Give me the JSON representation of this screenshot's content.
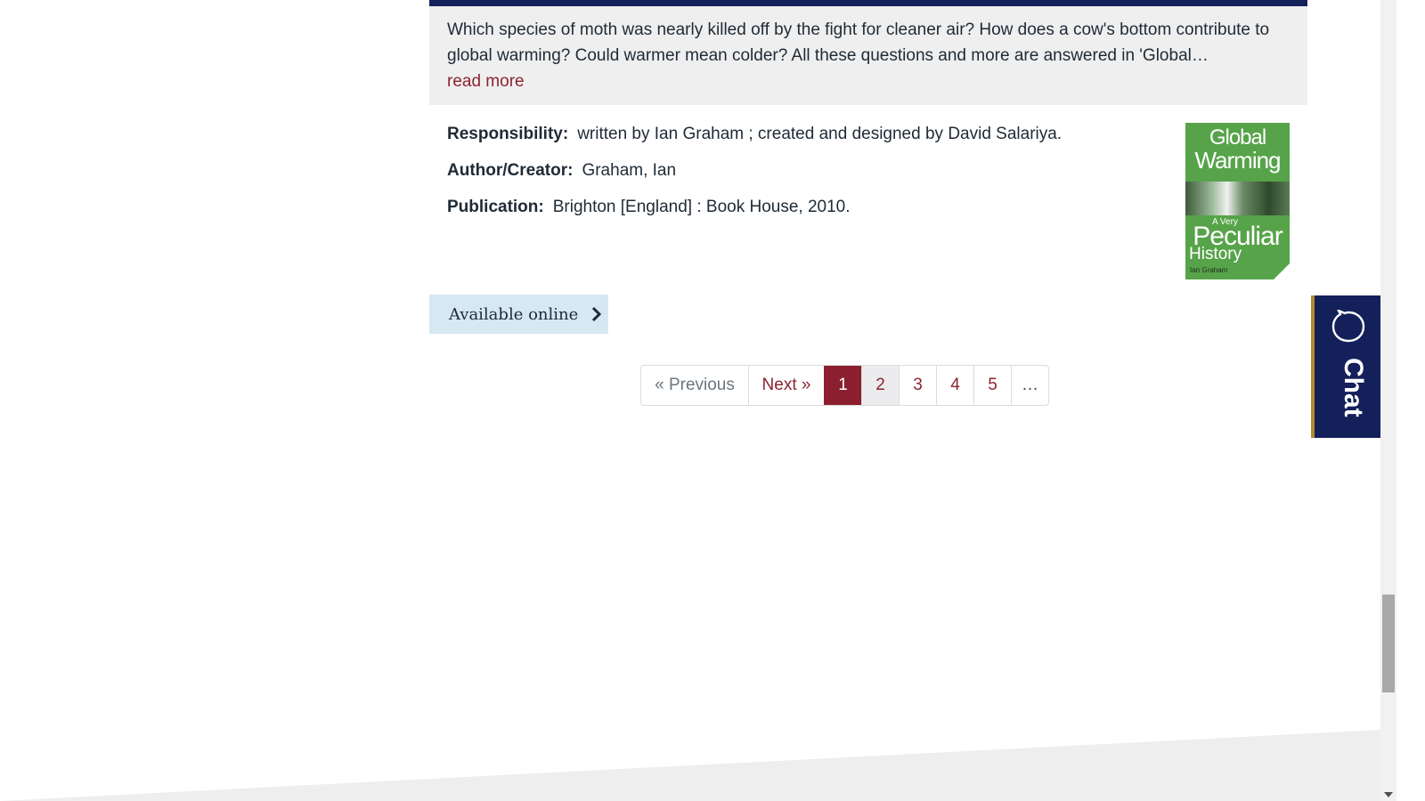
{
  "record": {
    "summary": "Which species of moth was nearly killed off by the fight for cleaner air? How does a cow's bottom contribute to global warming? Could warmer mean colder? All these questions and more are answered in 'Global…",
    "read_more": "read more",
    "fields": [
      {
        "label": "Responsibility:",
        "value": "written by Ian Graham ; created and designed by David Salariya."
      },
      {
        "label": "Author/Creator:",
        "value": "Graham, Ian"
      },
      {
        "label": "Publication:",
        "value": "Brighton [England] : Book House, 2010."
      }
    ],
    "cover": {
      "line1": "Global",
      "line2": "Warming",
      "subtitle": "A Very",
      "line3": "Peculiar",
      "line4": "History",
      "author": "Ian Graham",
      "color": "#57a34a"
    }
  },
  "available_online": {
    "label": "Available online",
    "icon": "chevron-right-icon"
  },
  "pagination": {
    "previous": "« Previous",
    "next": "Next »",
    "pages": [
      "1",
      "2",
      "3",
      "4",
      "5"
    ],
    "ellipsis": "…",
    "current": "1"
  },
  "chat": {
    "label": "Chat",
    "icon": "chat-bubble-icon"
  },
  "colors": {
    "accent": "#8c1f2f",
    "navy": "#13205a",
    "link": "#8c2331"
  }
}
